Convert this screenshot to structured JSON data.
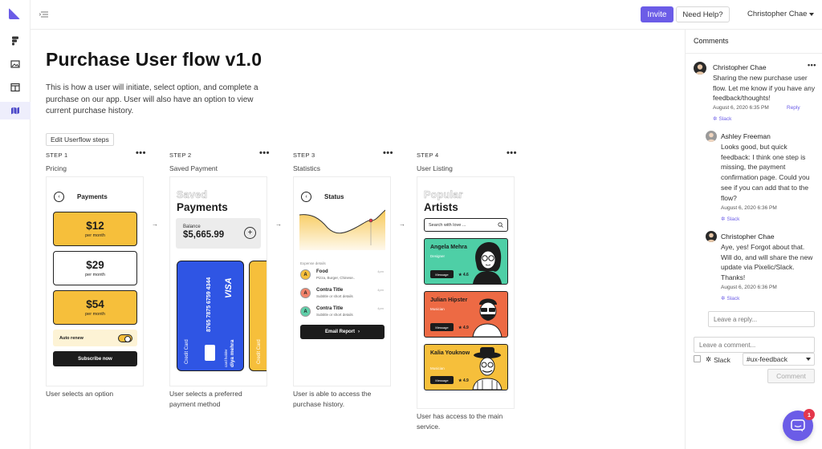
{
  "topbar": {
    "invite_label": "Invite",
    "help_label": "Need Help?",
    "user_name": "Christopher Chae"
  },
  "main": {
    "title": "Purchase User flow v1.0",
    "description": "This is how a user will initiate, select option, and complete a purchase on our app. User will also have an option to view current purchase history.",
    "edit_label": "Edit Userflow steps",
    "steps": [
      {
        "label": "STEP 1",
        "name": "Pricing",
        "caption": "User selects an option"
      },
      {
        "label": "STEP 2",
        "name": "Saved Payment",
        "caption": "User selects a preferred payment method"
      },
      {
        "label": "STEP 3",
        "name": "Statistics",
        "caption": "User is able to access the purchase history."
      },
      {
        "label": "STEP 4",
        "name": "User Listing",
        "caption": "User has access to the main service."
      }
    ],
    "more_glyph": "•••",
    "arrow_glyph": "→"
  },
  "pricing_card": {
    "back": "‹",
    "title": "Payments",
    "plans": [
      {
        "price": "$12",
        "period": "per month"
      },
      {
        "price": "$29",
        "period": "per month"
      },
      {
        "price": "$54",
        "period": "per month"
      }
    ],
    "renew_label": "Auto renew",
    "subscribe_label": "Subscribe now"
  },
  "payment_card": {
    "title_outline": "Saved",
    "title": "Payments",
    "balance_label": "Balance",
    "balance_amount": "$5,665.99",
    "plus": "+",
    "card_type": "Credit Card",
    "card_brand": "VISA",
    "card_number": "8765 7875 6759 4344",
    "card_holder_label": "card holder",
    "card_holder": "diya mehra",
    "card2_type": "Credit Card"
  },
  "status_card": {
    "back": "‹",
    "title": "Status",
    "expense_label": "Expense details",
    "expenses": [
      {
        "letter": "A",
        "title": "Food",
        "sub": "Pizza, Burger, Chinese..",
        "time": "4pm",
        "color": "#f6bf3b"
      },
      {
        "letter": "A",
        "title": "Contra Title",
        "sub": "Subtitle or short details",
        "time": "4pm",
        "color": "#f2836b"
      },
      {
        "letter": "A",
        "title": "Contra Title",
        "sub": "Subtitle or short details",
        "time": "4pm",
        "color": "#5fcfa9"
      }
    ],
    "report_label": "Email Report",
    "report_chevron": "›"
  },
  "listing_card": {
    "title_outline": "Popular",
    "title": "Artists",
    "search_placeholder": "Search with love ...",
    "artists": [
      {
        "name": "Angela Mehra",
        "role": "Designer",
        "rating": "4.6",
        "color": "#4ecfa6",
        "message": "Message"
      },
      {
        "name": "Julian Hipster",
        "role": "Musician",
        "rating": "4.9",
        "color": "#ed6a44",
        "message": "Message"
      },
      {
        "name": "Kalia Youknow",
        "role": "Musician",
        "rating": "4.9",
        "color": "#f6bf3b",
        "message": "Message"
      }
    ]
  },
  "comments": {
    "header": "Comments",
    "items": [
      {
        "name": "Christopher Chae",
        "body": "Sharing the new purchase user flow. Let me know if you have any feedback/thoughts!",
        "time": "August 6, 2020 6:35 PM",
        "reply": "Reply",
        "source": "Slack"
      },
      {
        "name": "Ashley Freeman",
        "body": "Looks good, but quick feedback: I think one step is missing, the payment confirmation page. Could you see if you can add that to the flow?",
        "time": "August 6, 2020 6:36 PM",
        "source": "Slack"
      },
      {
        "name": "Christopher Chae",
        "body": "Aye, yes! Forgot about that. Will do, and will share the new update via Pixelic/Slack. Thanks!",
        "time": "August 6, 2020 6:36 PM",
        "source": "Slack"
      }
    ],
    "more_glyph": "•••",
    "reply_placeholder": "Leave a reply...",
    "comment_placeholder": "Leave a comment...",
    "slack_label": "Slack",
    "channel": "#ux-feedback",
    "comment_button": "Comment"
  },
  "chat": {
    "badge": "1"
  },
  "colors": {
    "accent": "#6b5ce7",
    "gold": "#f6bf3b",
    "card_blue": "#2f55e4"
  }
}
